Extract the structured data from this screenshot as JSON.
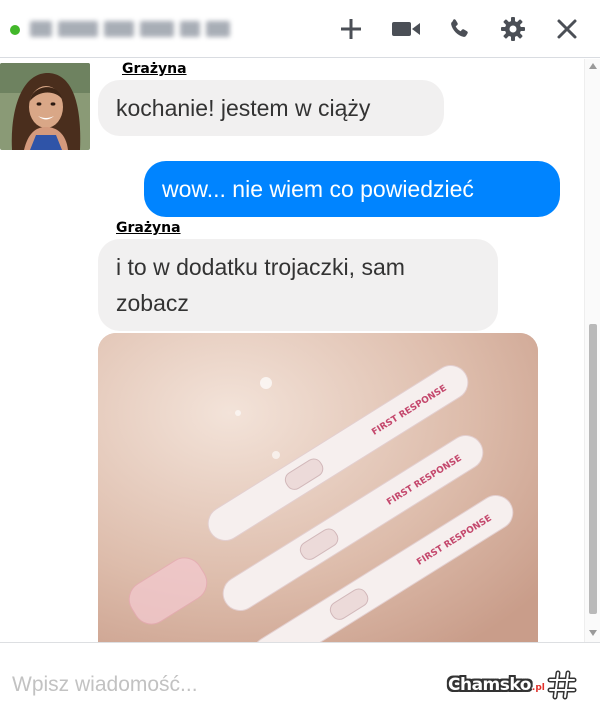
{
  "header": {
    "contact_name_blurred": true,
    "status_color": "#42b72a",
    "actions": [
      "add-icon",
      "video-call-icon",
      "phone-icon",
      "settings-gear-icon",
      "close-icon"
    ]
  },
  "conversation": {
    "messages": [
      {
        "sender": "Grażyna",
        "direction": "incoming",
        "text": "kochanie! jestem w ciąży"
      },
      {
        "sender": "",
        "direction": "outgoing",
        "text": "wow... nie wiem co powiedzieć"
      },
      {
        "sender": "Grażyna",
        "direction": "incoming",
        "lines": [
          "i to w dodatku trojaczki, sam",
          "zobacz"
        ]
      },
      {
        "sender": "Grażyna",
        "direction": "incoming",
        "attachment": "photo of three pregnancy tests",
        "test_brand": "FIRST RESPONSE"
      }
    ]
  },
  "composer": {
    "placeholder": "Wpisz wiadomość..."
  },
  "watermark": {
    "main": "Chamsko",
    "suffix": ".pl"
  },
  "colors": {
    "outgoing_bubble": "#0084ff",
    "incoming_bubble": "#f1f0f0",
    "icon_gray": "#4b4f56"
  }
}
